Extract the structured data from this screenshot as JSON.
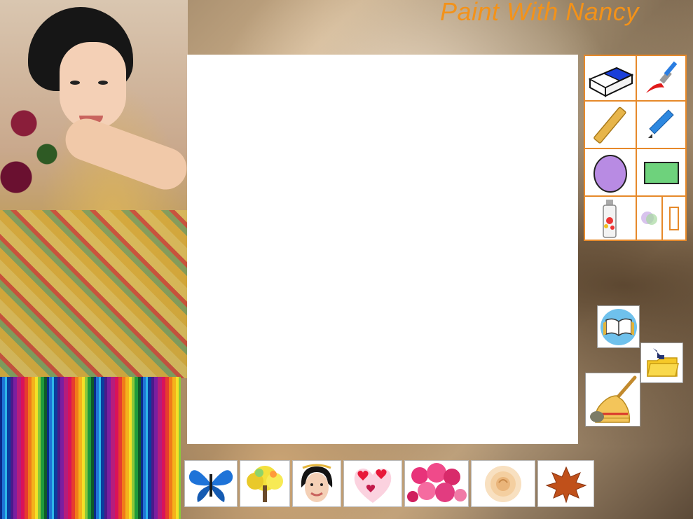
{
  "app": {
    "title": "Paint With Nancy"
  },
  "tools": [
    {
      "name": "eraser",
      "icon": "eraser-icon"
    },
    {
      "name": "paint-brush",
      "icon": "paintbrush-icon"
    },
    {
      "name": "ruler",
      "icon": "ruler-icon"
    },
    {
      "name": "pencil",
      "icon": "pencil-icon"
    },
    {
      "name": "ellipse",
      "icon": "ellipse-icon",
      "color": "#b88be3"
    },
    {
      "name": "rectangle",
      "icon": "rectangle-icon",
      "color": "#6ed27c"
    },
    {
      "name": "spray-can",
      "icon": "spraycan-icon"
    },
    {
      "name": "blur",
      "icon": "blur-icon"
    },
    {
      "name": "text-cursor",
      "icon": "text-cursor-icon"
    }
  ],
  "actions": [
    {
      "name": "open-book",
      "icon": "book-icon"
    },
    {
      "name": "save-folder",
      "icon": "folder-download-icon"
    },
    {
      "name": "clear-broom",
      "icon": "broom-icon"
    }
  ],
  "stamps": [
    {
      "name": "butterfly",
      "icon": "butterfly-icon"
    },
    {
      "name": "yellow-tree",
      "icon": "tree-icon"
    },
    {
      "name": "nancy-face",
      "icon": "face-icon"
    },
    {
      "name": "hearts",
      "icon": "hearts-icon"
    },
    {
      "name": "pink-blossoms",
      "icon": "blossom-icon"
    },
    {
      "name": "rose",
      "icon": "rose-icon"
    },
    {
      "name": "maple-leaf",
      "icon": "leaf-icon"
    }
  ],
  "colors": {
    "accent": "#f39219",
    "tool_border": "#e6892a"
  }
}
